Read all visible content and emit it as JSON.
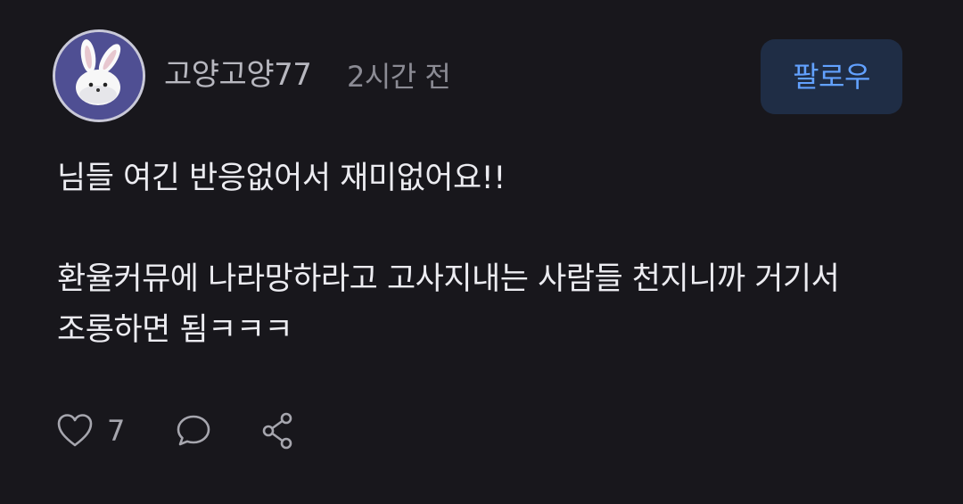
{
  "post": {
    "author": {
      "username": "고양고양77",
      "avatar_icon": "white-bunny-avatar"
    },
    "time": "2시간 전",
    "follow_label": "팔로우",
    "content": {
      "line1": "님들 여긴 반응없어서 재미없어요!!",
      "line2": "환율커뮤에 나라망하라고 고사지내는 사람들 천지니까 거기서",
      "line3": "조롱하면 됨ㅋㅋㅋ"
    },
    "actions": {
      "like_icon": "heart-icon",
      "like_count": "7",
      "comment_icon": "comment-icon",
      "share_icon": "share-icon"
    }
  },
  "colors": {
    "background": "#18171c",
    "accent": "#62a1ff",
    "follow_button_bg": "#1f2d45"
  }
}
